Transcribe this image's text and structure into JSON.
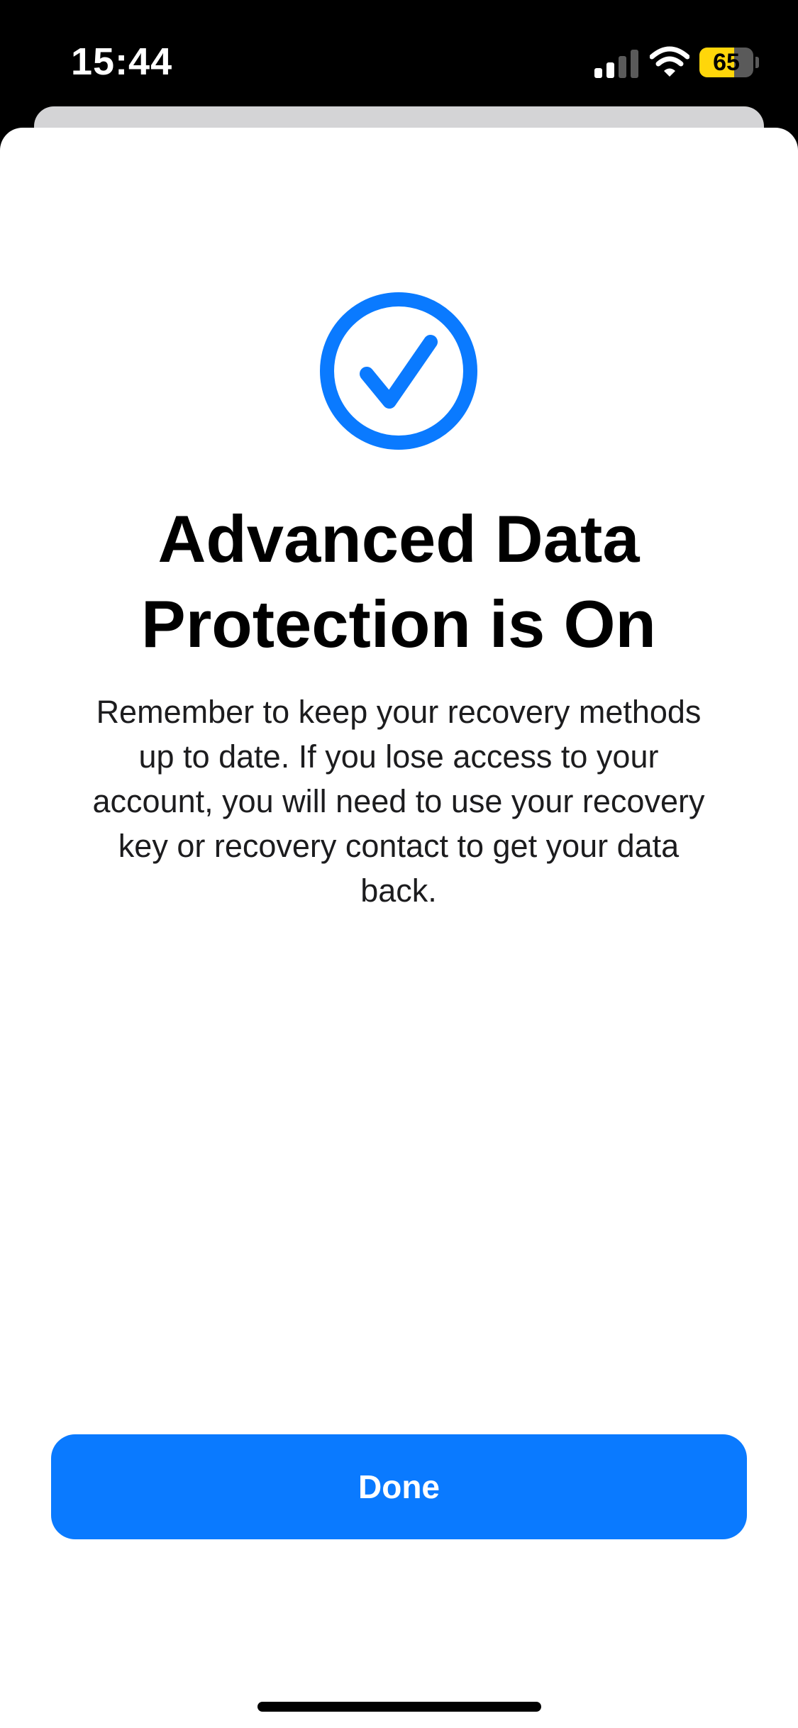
{
  "status_bar": {
    "time": "15:44",
    "battery_level": "65",
    "battery_fraction": 0.65,
    "signal_bars_active": 2,
    "signal_bars_total": 4,
    "icons": [
      "signal-icon",
      "wifi-icon",
      "battery-icon"
    ]
  },
  "sheet": {
    "icon": "checkmark-circle-icon",
    "title": "Advanced Data Protection is On",
    "body": "Remember to keep your recovery methods up to date. If you lose access to your account, you will need to use your recovery key or recovery contact to get your data back.",
    "done_label": "Done"
  },
  "colors": {
    "accent": "#0a7aff",
    "battery": "#ffd60a",
    "background": "#ffffff",
    "status_bar": "#000000"
  }
}
